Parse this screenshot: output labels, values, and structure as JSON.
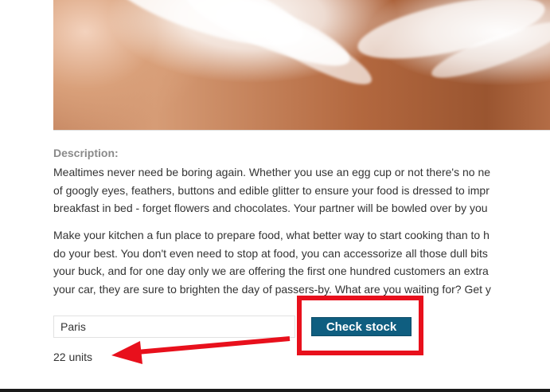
{
  "product": {
    "image_alt": "feathers"
  },
  "description": {
    "heading": "Description:",
    "paragraph_1": [
      "Mealtimes never need be boring again. Whether you use an egg cup or not there's no ne",
      "of googly eyes, feathers, buttons and edible glitter to ensure your food is dressed to impr",
      "breakfast in bed - forget flowers and chocolates. Your partner will be bowled over by you"
    ],
    "paragraph_2": [
      "Make your kitchen a fun place to prepare food, what better way to start cooking than to h",
      "do your best. You don't even need to stop at food, you can accessorize all those dull bits",
      "your buck, and for one day only we are offering the first one hundred customers an extra",
      "your car, they are sure to brighten the day of passers-by. What are you waiting for? Get y"
    ]
  },
  "stock_check": {
    "selected_store": "Paris",
    "button_label": "Check stock",
    "result": "22 units"
  },
  "annotation": {
    "highlight_color": "#e8101c",
    "button_color": "#0f5e80"
  }
}
